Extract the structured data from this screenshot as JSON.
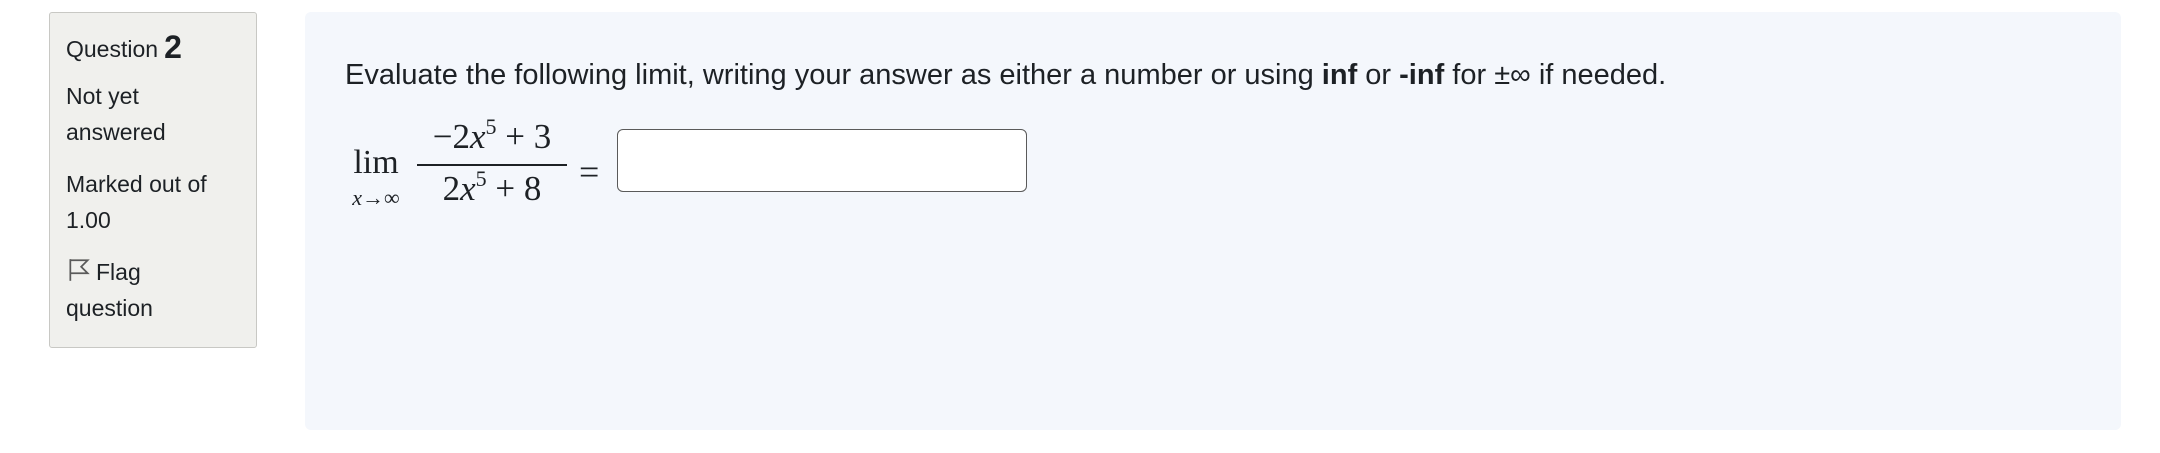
{
  "info": {
    "question_word": "Question",
    "question_number": "2",
    "state_line1": "Not yet",
    "state_line2": "answered",
    "grade_line1": "Marked out of",
    "grade_line2": "1.00",
    "flag_line1": "Flag",
    "flag_line2": "question",
    "flag_icon": "flag-outline-icon"
  },
  "question": {
    "text_before": "Evaluate the following limit, writing your answer as either a number or using ",
    "bold_inf": "inf",
    "text_or": " or ",
    "bold_neg_inf": "-inf",
    "text_for": " for ±∞ if needed."
  },
  "formula": {
    "lim": "lim",
    "sub_var": "x",
    "sub_arrow": "→",
    "sub_inf": "∞",
    "numerator_coef": "−2",
    "numerator_var": "x",
    "numerator_exp": "5",
    "numerator_rest": " + 3",
    "denominator_coef": "2",
    "denominator_var": "x",
    "denominator_exp": "5",
    "denominator_rest": " + 8",
    "equals": "="
  },
  "answer": {
    "value": "",
    "placeholder": ""
  }
}
